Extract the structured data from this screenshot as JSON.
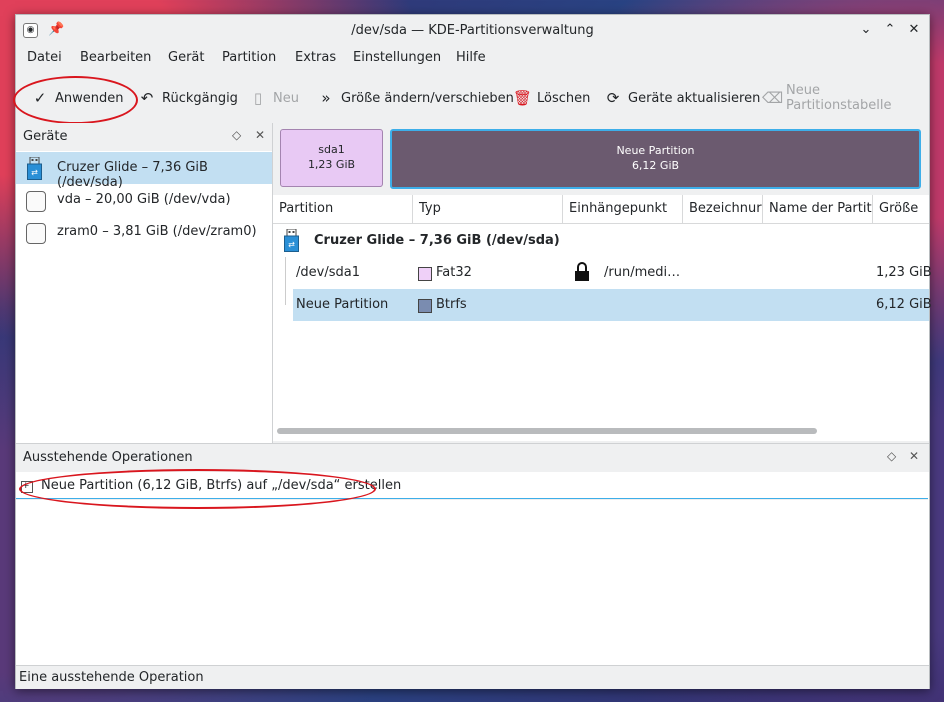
{
  "window": {
    "title": "/dev/sda — KDE-Partitionsverwaltung",
    "app_icon": "partitionmanager-icon",
    "pin_icon": "pin-icon",
    "controls": [
      "chevron-down-icon",
      "chevron-up-icon",
      "close-icon"
    ]
  },
  "menubar": [
    "Datei",
    "Bearbeiten",
    "Gerät",
    "Partition",
    "Extras",
    "Einstellungen",
    "Hilfe"
  ],
  "toolbar": {
    "apply": "Anwenden",
    "undo": "Rückgängig",
    "new": "Neu",
    "resize": "Größe ändern/verschieben",
    "delete": "Löschen",
    "refresh": "Geräte aktualisieren",
    "new_table": "Neue Partitionstabelle"
  },
  "devices_panel": {
    "title": "Geräte",
    "items": [
      {
        "label": "Cruzer Glide – 7,36 GiB (/dev/sda)",
        "icon": "usb-drive-icon",
        "selected": true
      },
      {
        "label": "vda – 20,00 GiB (/dev/vda)",
        "icon": "hard-disk-icon",
        "selected": false
      },
      {
        "label": "zram0 – 3,81 GiB (/dev/zram0)",
        "icon": "hard-disk-icon",
        "selected": false
      }
    ]
  },
  "partition_bar": [
    {
      "name": "sda1",
      "size": "1,23 GiB",
      "color": "#e8c9f4"
    },
    {
      "name": "Neue Partition",
      "size": "6,12 GiB",
      "color": "#6b5a6f"
    }
  ],
  "table": {
    "headers": [
      "Partition",
      "Typ",
      "Einhängepunkt",
      "Bezeichnur",
      "Name der Partit",
      "Größe"
    ],
    "device_row": "Cruzer Glide – 7,36 GiB (/dev/sda)",
    "rows": [
      {
        "partition": "/dev/sda1",
        "type": "Fat32",
        "type_color": "#efd0f8",
        "locked": true,
        "mount": "/run/medi…",
        "size": "1,23 GiB",
        "selected": false
      },
      {
        "partition": "Neue Partition",
        "type": "Btrfs",
        "type_color": "#7a8cb0",
        "locked": false,
        "mount": "",
        "size": "6,12 GiB",
        "selected": true
      }
    ]
  },
  "operations_panel": {
    "title": "Ausstehende Operationen",
    "items": [
      "Neue Partition (6,12 GiB, Btrfs) auf „/dev/sda“ erstellen"
    ]
  },
  "statusbar": "Eine ausstehende Operation",
  "accent_colors": {
    "selection": "#c2dff2",
    "highlight": "#3daee9",
    "annotation": "#d9161e"
  }
}
